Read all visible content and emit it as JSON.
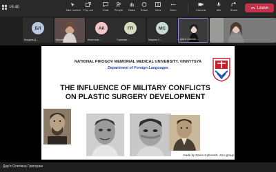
{
  "toolbar": {
    "time": "15:40",
    "items": [
      {
        "label": "Take control",
        "icon": "take-control-icon"
      },
      {
        "label": "Pop out",
        "icon": "pop-out-icon"
      },
      {
        "label": "Chat",
        "icon": "chat-icon"
      },
      {
        "label": "People",
        "icon": "people-icon"
      },
      {
        "label": "Raise",
        "icon": "raise-hand-icon"
      },
      {
        "label": "React",
        "icon": "react-icon"
      },
      {
        "label": "View",
        "icon": "view-icon"
      },
      {
        "label": "More",
        "icon": "more-icon"
      },
      {
        "label": "Camera",
        "icon": "camera-icon"
      },
      {
        "label": "Mic",
        "icon": "mic-icon"
      },
      {
        "label": "Share",
        "icon": "share-icon"
      }
    ],
    "leave_label": "Leave",
    "leave_color": "#c4314b"
  },
  "participants": [
    {
      "initials": "БЛ",
      "name": "Богдана Д...",
      "color": "#b8c8df",
      "kind": "initials"
    },
    {
      "initials": "",
      "name": "Михайлин...",
      "color": "#6b5a5a",
      "kind": "video"
    },
    {
      "initials": "АК",
      "name": "Анастасія ...",
      "color": "#f2c6c2",
      "kind": "initials"
    },
    {
      "initials": "ГП",
      "name": "Горленко ...",
      "color": "#d7dcc1",
      "kind": "initials"
    },
    {
      "initials": "МС",
      "name": "Марина С...",
      "color": "#c6dcd1",
      "kind": "initials"
    },
    {
      "initials": "",
      "name": "Дар'я Олегівн...",
      "color": "#5b5b5b",
      "kind": "video"
    }
  ],
  "slide": {
    "university": "NATIONAL PIROGOV MEMORIAL MEDICAL UNIVERSITY, VINNYTSYA",
    "department": "Department of Foreign Languages",
    "title": "THE INFLUENCE OF MILITARY CONFLICTS ON PLASTIC SURGERY DEVELOPMENT",
    "credit": "made by Daria Hryhorash, 15-b group"
  },
  "presenter_name": "Дар'я Олегівна Григораш"
}
